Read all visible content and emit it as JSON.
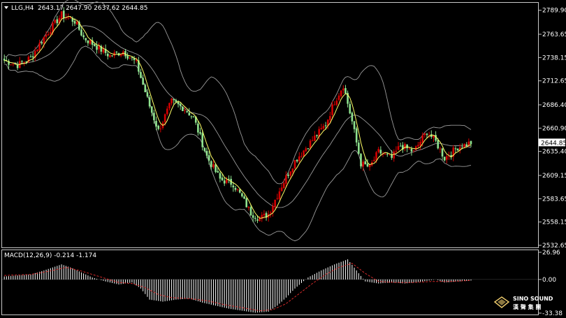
{
  "header": {
    "symbol_label": "LLG,H4",
    "ohlc_text": "2643.17 2647.90 2637.62 2644.85",
    "macd_label": "MACD(12,26,9) -0.214 -1.174"
  },
  "brand": {
    "logo_line1": "SINO SOUND",
    "logo_line2": "漢 聲 集 團"
  },
  "colors": {
    "background": "#000000",
    "bull": "#d40000",
    "bear": "#8fe38f",
    "ma": "#ffff66",
    "bands": "#9a9a9a",
    "signal": "#d42a2a",
    "histogram": "#ffffff",
    "price_tag_bg": "#ffffff",
    "price_tag_text": "#000000"
  },
  "chart_data": [
    {
      "type": "candlestick",
      "instrument": "LLG",
      "timeframe": "H4",
      "ylim": [
        2532.65,
        2795
      ],
      "yticks": [
        "2789.90",
        "2763.65",
        "2738.15",
        "2712.65",
        "2686.40",
        "2660.90",
        "2635.40",
        "2609.15",
        "2583.65",
        "2558.15",
        "2532.65"
      ],
      "current_price": "2644.85",
      "overlays": [
        "moving average",
        "bollinger bands"
      ],
      "anchors": [
        [
          0,
          2735
        ],
        [
          6,
          2730
        ],
        [
          12,
          2738
        ],
        [
          18,
          2760
        ],
        [
          26,
          2785
        ],
        [
          32,
          2778
        ],
        [
          36,
          2760
        ],
        [
          42,
          2750
        ],
        [
          48,
          2740
        ],
        [
          54,
          2745
        ],
        [
          60,
          2732
        ],
        [
          66,
          2685
        ],
        [
          70,
          2658
        ],
        [
          76,
          2690
        ],
        [
          82,
          2682
        ],
        [
          86,
          2672
        ],
        [
          92,
          2630
        ],
        [
          98,
          2605
        ],
        [
          104,
          2600
        ],
        [
          108,
          2585
        ],
        [
          112,
          2568
        ],
        [
          116,
          2562
        ],
        [
          120,
          2567
        ],
        [
          126,
          2598
        ],
        [
          132,
          2625
        ],
        [
          140,
          2648
        ],
        [
          146,
          2665
        ],
        [
          150,
          2690
        ],
        [
          154,
          2708
        ],
        [
          158,
          2668
        ],
        [
          162,
          2622
        ],
        [
          166,
          2618
        ],
        [
          170,
          2635
        ],
        [
          176,
          2628
        ],
        [
          180,
          2642
        ],
        [
          186,
          2635
        ],
        [
          190,
          2650
        ],
        [
          192,
          2657
        ],
        [
          196,
          2646
        ],
        [
          200,
          2628
        ],
        [
          206,
          2640
        ],
        [
          212,
          2645
        ]
      ]
    },
    {
      "type": "macd",
      "params": "12,26,9",
      "main": "-0.214",
      "signal": "-1.174",
      "ylim": [
        -33.38,
        26.96
      ],
      "yticks": [
        "26.96",
        "0.00",
        "-33.38"
      ],
      "anchors": [
        [
          0,
          3
        ],
        [
          12,
          5
        ],
        [
          18,
          9
        ],
        [
          26,
          15
        ],
        [
          30,
          12
        ],
        [
          36,
          6
        ],
        [
          40,
          2
        ],
        [
          46,
          -2
        ],
        [
          52,
          -5
        ],
        [
          58,
          -3
        ],
        [
          62,
          -9
        ],
        [
          66,
          -20
        ],
        [
          72,
          -22
        ],
        [
          78,
          -20
        ],
        [
          84,
          -19
        ],
        [
          90,
          -23
        ],
        [
          96,
          -26
        ],
        [
          102,
          -29
        ],
        [
          108,
          -31
        ],
        [
          114,
          -33
        ],
        [
          120,
          -32
        ],
        [
          124,
          -26
        ],
        [
          128,
          -18
        ],
        [
          132,
          -9
        ],
        [
          138,
          2
        ],
        [
          144,
          9
        ],
        [
          150,
          15
        ],
        [
          156,
          20
        ],
        [
          160,
          9
        ],
        [
          164,
          -2
        ],
        [
          170,
          -4
        ],
        [
          176,
          -3
        ],
        [
          182,
          -4
        ],
        [
          190,
          -2
        ],
        [
          196,
          0
        ],
        [
          200,
          -3
        ],
        [
          206,
          -2
        ],
        [
          212,
          -1
        ]
      ],
      "signal_anchors": [
        [
          0,
          4
        ],
        [
          12,
          5
        ],
        [
          20,
          8
        ],
        [
          28,
          12
        ],
        [
          34,
          9
        ],
        [
          40,
          5
        ],
        [
          46,
          1
        ],
        [
          52,
          -3
        ],
        [
          58,
          -4
        ],
        [
          64,
          -8
        ],
        [
          70,
          -15
        ],
        [
          76,
          -18
        ],
        [
          84,
          -19
        ],
        [
          92,
          -21
        ],
        [
          100,
          -25
        ],
        [
          108,
          -28
        ],
        [
          116,
          -31
        ],
        [
          122,
          -30
        ],
        [
          128,
          -24
        ],
        [
          134,
          -14
        ],
        [
          140,
          -4
        ],
        [
          146,
          5
        ],
        [
          152,
          12
        ],
        [
          158,
          16
        ],
        [
          164,
          6
        ],
        [
          170,
          -2
        ],
        [
          178,
          -3
        ],
        [
          186,
          -3
        ],
        [
          194,
          -2
        ],
        [
          202,
          -2
        ],
        [
          212,
          -1
        ]
      ]
    }
  ]
}
